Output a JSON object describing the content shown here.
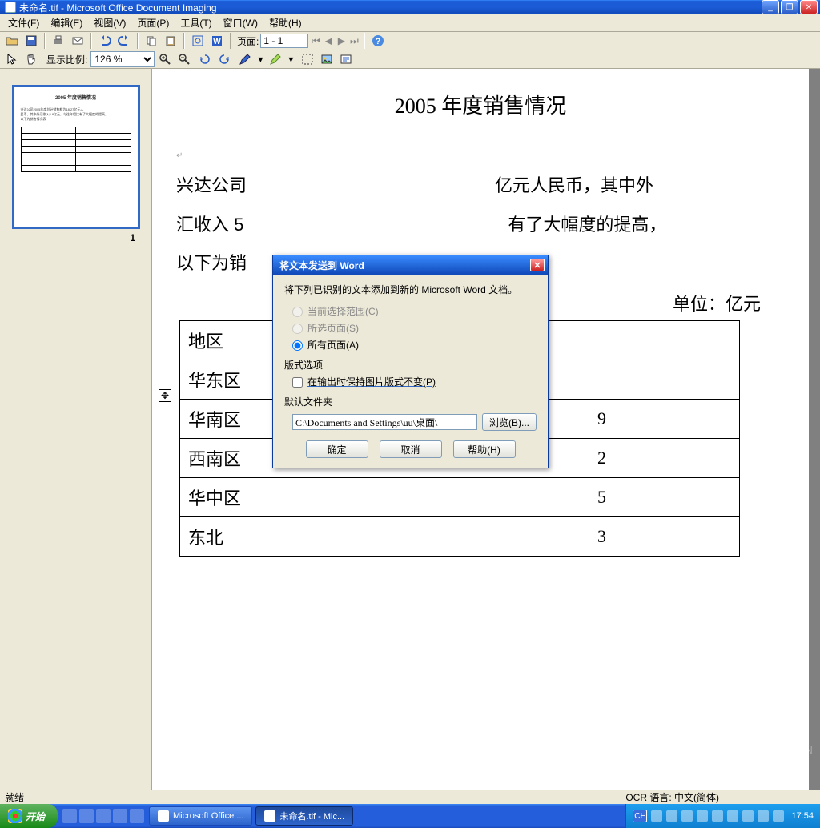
{
  "titlebar": {
    "title": "未命名.tif - Microsoft Office Document Imaging"
  },
  "menu": {
    "file": "文件(F)",
    "edit": "编辑(E)",
    "view": "视图(V)",
    "page": "页面(P)",
    "tools": "工具(T)",
    "window": "窗口(W)",
    "help": "帮助(H)"
  },
  "toolbar": {
    "page_label": "页面:",
    "page_field": "1 - 1"
  },
  "toolbar2": {
    "zoom_label": "显示比例:",
    "zoom_value": "126 %"
  },
  "thumb": {
    "title": "2005 年度销售情况",
    "number": "1"
  },
  "document": {
    "title": "2005 年度销售情况",
    "line1": "兴达公司",
    "line1b": "亿元人民币，其中外",
    "line2": "汇收入 5",
    "line2b": "有了大幅度的提高，",
    "line3": "以下为销",
    "unit": "单位：亿元",
    "rows": [
      {
        "region": "地区",
        "val": ""
      },
      {
        "region": "华东区",
        "val": ""
      },
      {
        "region": "华南区",
        "val": "9"
      },
      {
        "region": "西南区",
        "val": "2"
      },
      {
        "region": "华中区",
        "val": "5"
      },
      {
        "region": "东北",
        "val": "3"
      }
    ]
  },
  "dialog": {
    "title": "将文本发送到 Word",
    "desc": "将下列已识别的文本添加到新的 Microsoft Word 文档。",
    "radio1": "当前选择范围(C)",
    "radio2": "所选页面(S)",
    "radio3": "所有页面(A)",
    "layout_hdr": "版式选项",
    "checkbox": "在输出时保持图片版式不变(P)",
    "folder_hdr": "默认文件夹",
    "folder_path": "C:\\Documents and Settings\\uu\\桌面\\",
    "browse": "浏览(B)...",
    "ok": "确定",
    "cancel": "取消",
    "help": "帮助(H)"
  },
  "status": {
    "ready": "就绪",
    "ocr": "OCR 语言: 中文(简体)"
  },
  "taskbar": {
    "start": "开始",
    "task1": "Microsoft Office ...",
    "task2": "未命名.tif - Mic...",
    "lang": "CH",
    "clock": "17:54"
  },
  "watermark": "BBS.PCHOME.COM.CN"
}
